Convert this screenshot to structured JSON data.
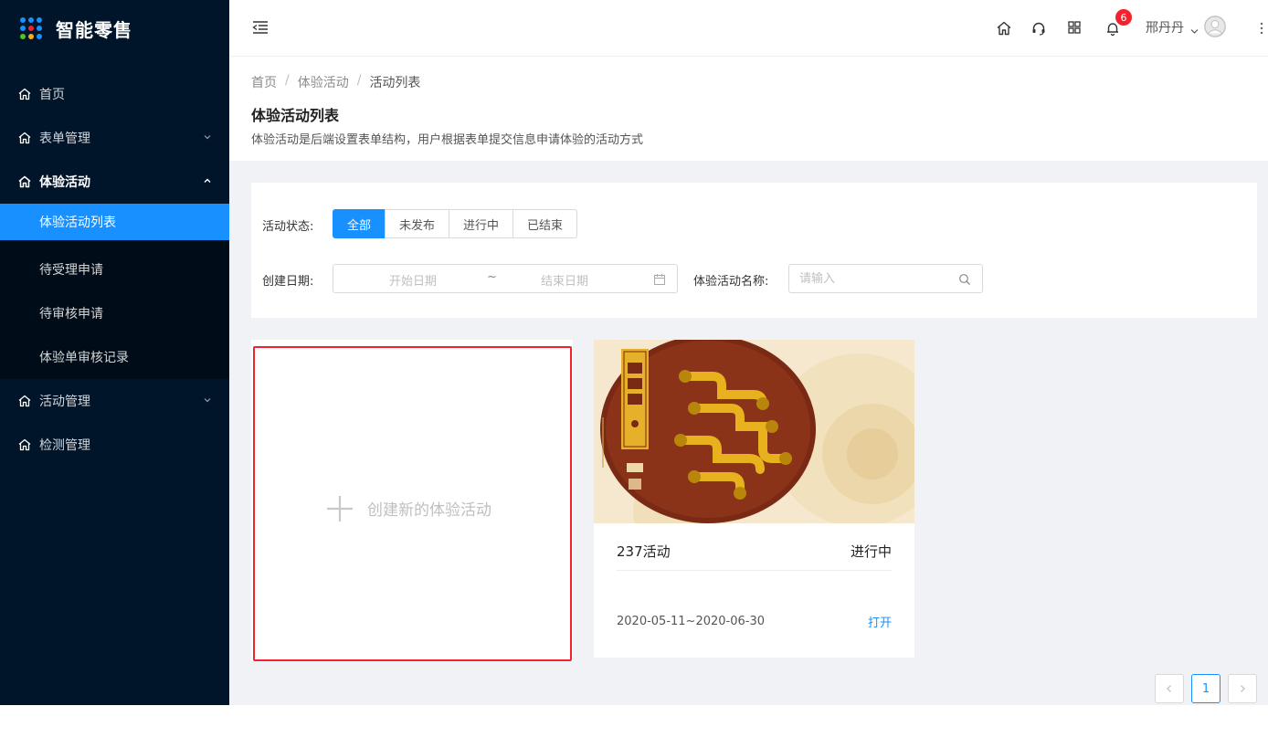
{
  "app": {
    "name": "智能零售"
  },
  "colors": {
    "sidebar_bg": "#001529",
    "accent": "#1890ff",
    "badge": "#f5222d"
  },
  "sidebar": {
    "items": [
      {
        "label": "首页",
        "icon": "home-icon"
      },
      {
        "label": "表单管理",
        "icon": "home-icon",
        "expandable": true
      },
      {
        "label": "体验活动",
        "icon": "home-icon",
        "expanded": true,
        "children": [
          {
            "label": "体验活动列表",
            "active": true
          },
          {
            "label": "待受理申请"
          },
          {
            "label": "待审核申请"
          },
          {
            "label": "体验单审核记录"
          }
        ]
      },
      {
        "label": "活动管理",
        "icon": "home-icon",
        "expandable": true
      },
      {
        "label": "检测管理",
        "icon": "home-icon"
      }
    ]
  },
  "header": {
    "notifications": "6",
    "user": "邢丹丹"
  },
  "breadcrumb": [
    "首页",
    "体验活动",
    "活动列表"
  ],
  "page": {
    "title": "体验活动列表",
    "description": "体验活动是后端设置表单结构，用户根据表单提交信息申请体验的活动方式"
  },
  "filters": {
    "status_label": "活动状态:",
    "status_options": [
      "全部",
      "未发布",
      "进行中",
      "已结束"
    ],
    "status_selected": "全部",
    "date_label": "创建日期:",
    "date_start_placeholder": "开始日期",
    "date_sep": "~",
    "date_end_placeholder": "结束日期",
    "name_label": "体验活动名称:",
    "name_placeholder": "请输入"
  },
  "create_card": {
    "label": "创建新的体验活动"
  },
  "activities": [
    {
      "name": "237活动",
      "status": "进行中",
      "dates": "2020-05-11~2020-06-30",
      "action": "打开"
    }
  ],
  "pagination": {
    "current": "1"
  }
}
